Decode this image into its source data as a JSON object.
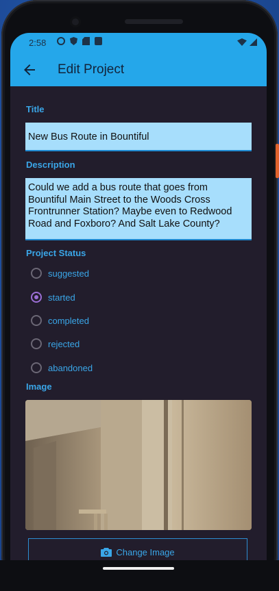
{
  "status_bar": {
    "time": "2:58",
    "icons": [
      "circle-icon",
      "shield-icon",
      "sd-card-icon",
      "a-icon",
      "wifi-icon",
      "signal-icon"
    ]
  },
  "app_bar": {
    "title": "Edit Project",
    "back_icon": "back-arrow-icon"
  },
  "form": {
    "title_label": "Title",
    "title_value": "New Bus Route in Bountiful",
    "description_label": "Description",
    "description_value": "Could we add a bus route that goes from Bountiful Main Street to the Woods Cross Frontrunner Station? Maybe even to Redwood Road and Foxboro? And Salt Lake County?",
    "status_label": "Project Status",
    "status_options": [
      {
        "label": "suggested",
        "checked": false
      },
      {
        "label": "started",
        "checked": true
      },
      {
        "label": "completed",
        "checked": false
      },
      {
        "label": "rejected",
        "checked": false
      },
      {
        "label": "abandoned",
        "checked": false
      }
    ],
    "image_label": "Image",
    "change_image_label": "Change Image"
  },
  "colors": {
    "accent": "#25a7ea",
    "background": "#221d2c",
    "field": "#a7defc",
    "radio_checked": "#9c6fd6"
  }
}
